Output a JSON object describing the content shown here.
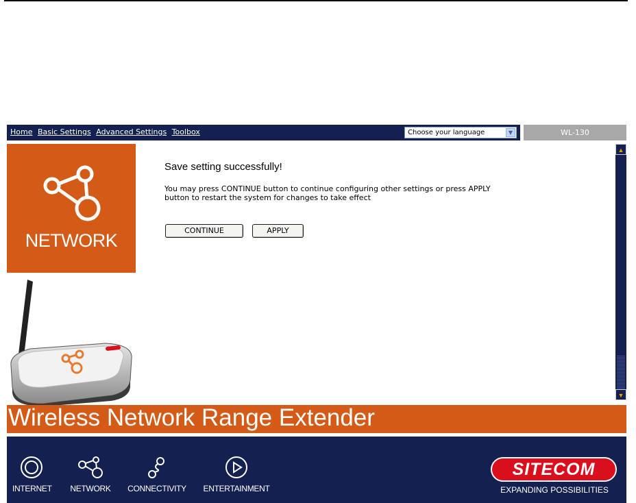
{
  "nav": {
    "links": [
      "Home",
      "Basic Settings",
      "Advanced Settings",
      "Toolbox"
    ],
    "language_select": "Choose your language",
    "model": "WL-130"
  },
  "left": {
    "section_label": "NETWORK"
  },
  "main": {
    "title": "Save setting successfully!",
    "message_line1": "You may press CONTINUE button to continue configuring other settings or press APPLY",
    "message_line2": "button to restart the system for changes to take effect",
    "continue_label": "CONTINUE",
    "apply_label": "APPLY"
  },
  "banner": {
    "text": "Wireless Network Range Extender"
  },
  "footer": {
    "items": [
      "INTERNET",
      "NETWORK",
      "CONNECTIVITY",
      "ENTERTAINMENT"
    ],
    "logo": "SITECOM",
    "tagline": "EXPANDING POSSIBILITIES"
  },
  "colors": {
    "navy": "#142050",
    "orange": "#d45b17",
    "brand_red": "#d90f1d"
  },
  "icons": [
    "network-icon",
    "internet-icon",
    "connectivity-icon",
    "entertainment-icon",
    "scroll-up-icon",
    "scroll-down-icon",
    "dropdown-arrow-icon"
  ]
}
